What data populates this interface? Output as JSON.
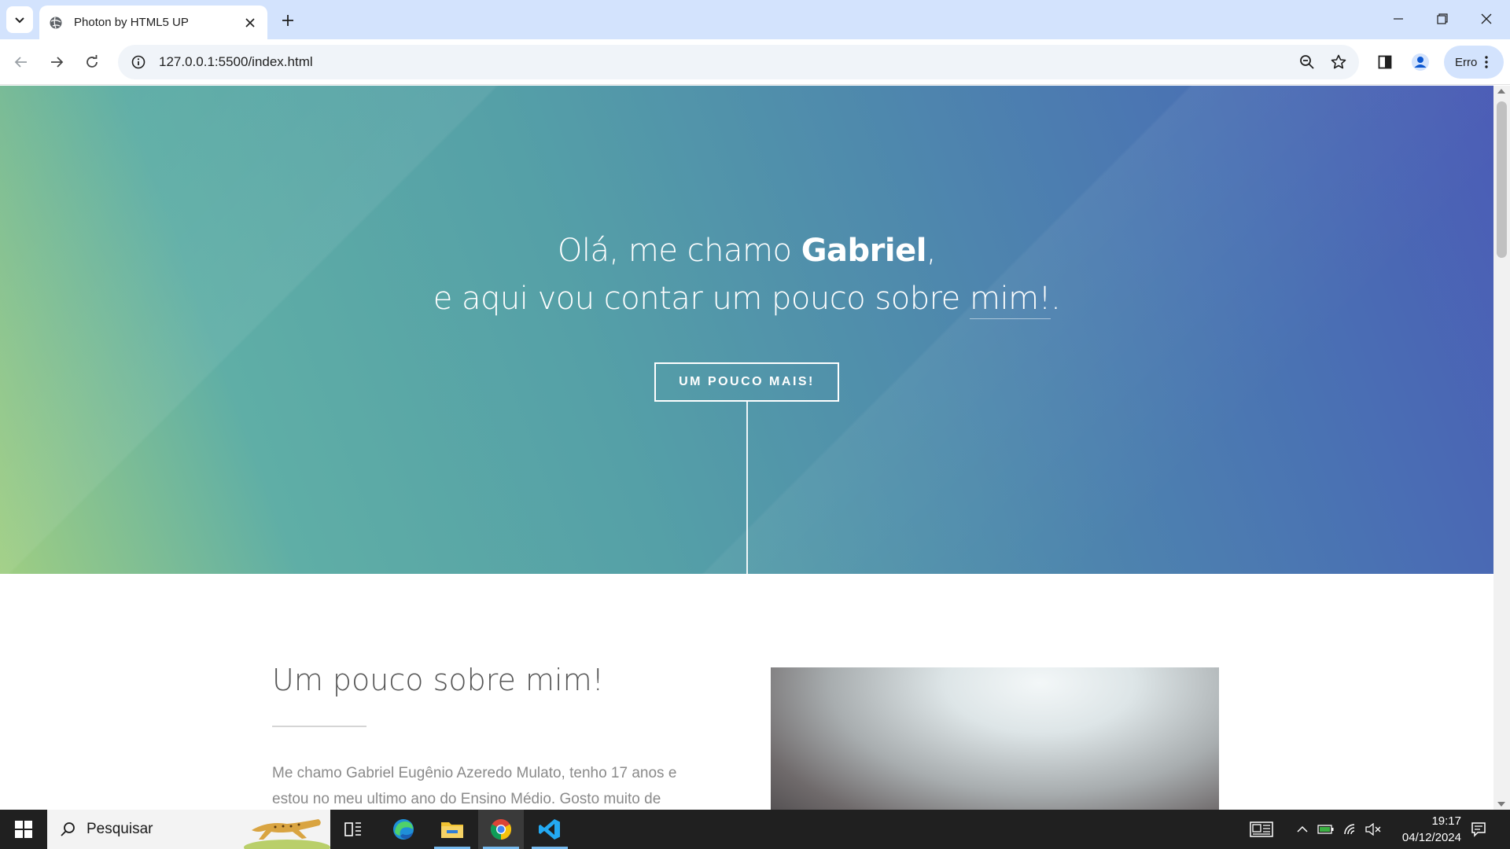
{
  "browser": {
    "tab_title": "Photon by HTML5 UP",
    "url": "127.0.0.1:5500/index.html",
    "profile_label": "Erro"
  },
  "banner": {
    "line1_prefix": "Olá, me chamo ",
    "line1_name": "Gabriel",
    "line1_suffix": ",",
    "line2_prefix": "e aqui vou contar um pouco sobre ",
    "line2_link": "mim!",
    "line2_suffix": ".",
    "cta_label": "UM POUCO MAIS!"
  },
  "about": {
    "title": "Um pouco sobre mim!",
    "text": "Me chamo Gabriel Eugênio Azeredo Mulato, tenho 17 anos e estou no meu ultimo ano do Ensino Médio. Gosto muito de tecnologia e jogar,"
  },
  "taskbar": {
    "search_label": "Pesquisar",
    "time": "19:17",
    "date": "04/12/2024"
  },
  "colors": {
    "tabbar_bg": "#d3e3fd",
    "banner_start": "#9fce82",
    "banner_end": "#4b5cb6",
    "taskbar_bg": "#202020"
  },
  "icons": [
    "tab-search-icon",
    "globe-icon",
    "close-icon",
    "plus-icon",
    "minimize-icon",
    "restore-icon",
    "window-close-icon",
    "back-icon",
    "forward-icon",
    "reload-icon",
    "info-icon",
    "zoom-icon",
    "star-icon",
    "side-panel-icon",
    "profile-icon",
    "more-icon",
    "windows-icon",
    "search-icon",
    "task-view-icon",
    "edge-icon",
    "explorer-icon",
    "chrome-icon",
    "vscode-icon",
    "news-icon",
    "chevron-up-icon",
    "battery-icon",
    "wifi-icon",
    "mute-icon",
    "notifications-icon"
  ]
}
